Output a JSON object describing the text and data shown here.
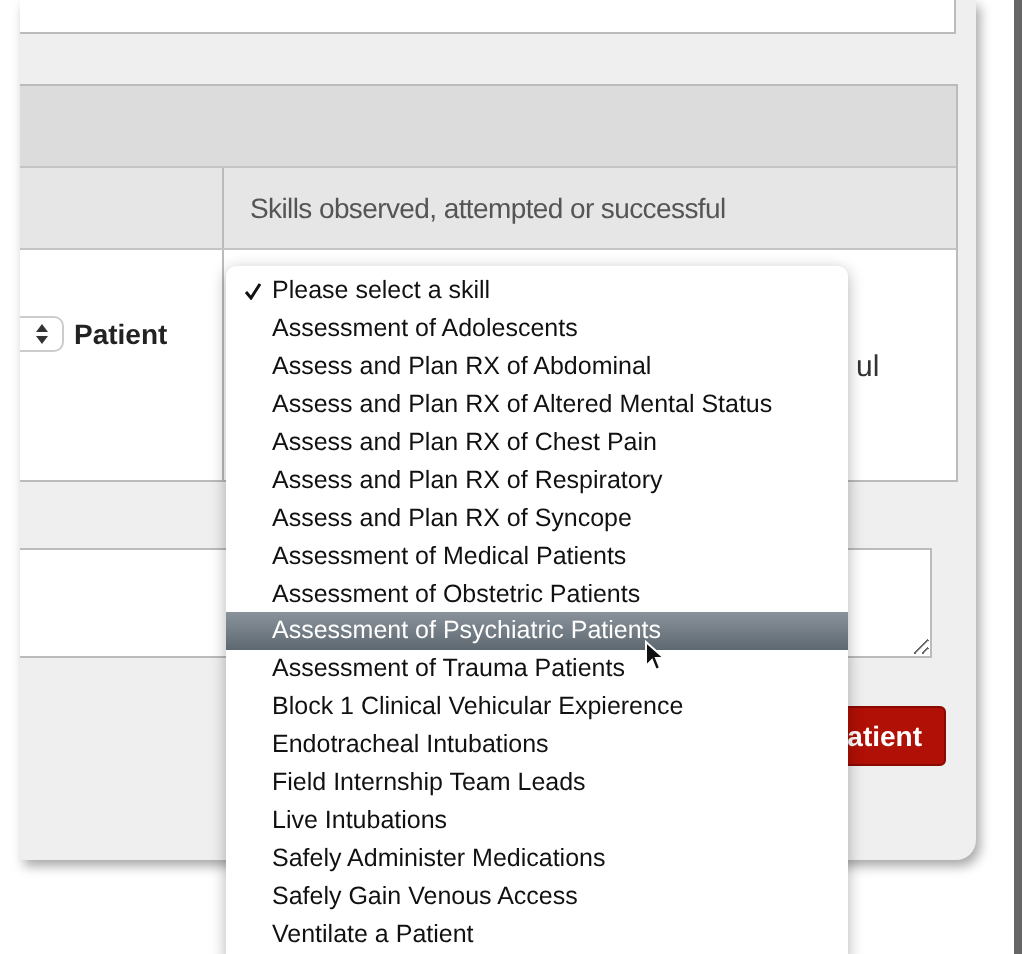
{
  "table": {
    "skills_header": "Skills observed, attempted or successful",
    "patient_select": {
      "label": "Patient"
    },
    "partly_hidden_text": "ul"
  },
  "buttons": [
    {
      "label": "atient",
      "kind": "primary"
    }
  ],
  "skill_menu": {
    "items": [
      {
        "label": "Please select a skill",
        "checked": true,
        "selected": false
      },
      {
        "label": "Assessment of Adolescents",
        "checked": false,
        "selected": false
      },
      {
        "label": "Assess and Plan RX of Abdominal",
        "checked": false,
        "selected": false
      },
      {
        "label": "Assess and Plan RX of Altered Mental Status",
        "checked": false,
        "selected": false
      },
      {
        "label": "Assess and Plan RX of Chest Pain",
        "checked": false,
        "selected": false
      },
      {
        "label": "Assess and Plan RX of Respiratory",
        "checked": false,
        "selected": false
      },
      {
        "label": "Assess and Plan RX of Syncope",
        "checked": false,
        "selected": false
      },
      {
        "label": "Assessment of Medical Patients",
        "checked": false,
        "selected": false
      },
      {
        "label": "Assessment of Obstetric Patients",
        "checked": false,
        "selected": false
      },
      {
        "label": "Assessment of Psychiatric Patients",
        "checked": false,
        "selected": true
      },
      {
        "label": "Assessment of Trauma Patients",
        "checked": false,
        "selected": false
      },
      {
        "label": "Block 1 Clinical Vehicular Expierence",
        "checked": false,
        "selected": false
      },
      {
        "label": "Endotracheal Intubations",
        "checked": false,
        "selected": false
      },
      {
        "label": "Field Internship Team Leads",
        "checked": false,
        "selected": false
      },
      {
        "label": "Live Intubations",
        "checked": false,
        "selected": false
      },
      {
        "label": "Safely Administer Medications",
        "checked": false,
        "selected": false
      },
      {
        "label": "Safely Gain Venous Access",
        "checked": false,
        "selected": false
      },
      {
        "label": "Ventilate a Patient",
        "checked": false,
        "selected": false
      }
    ]
  }
}
